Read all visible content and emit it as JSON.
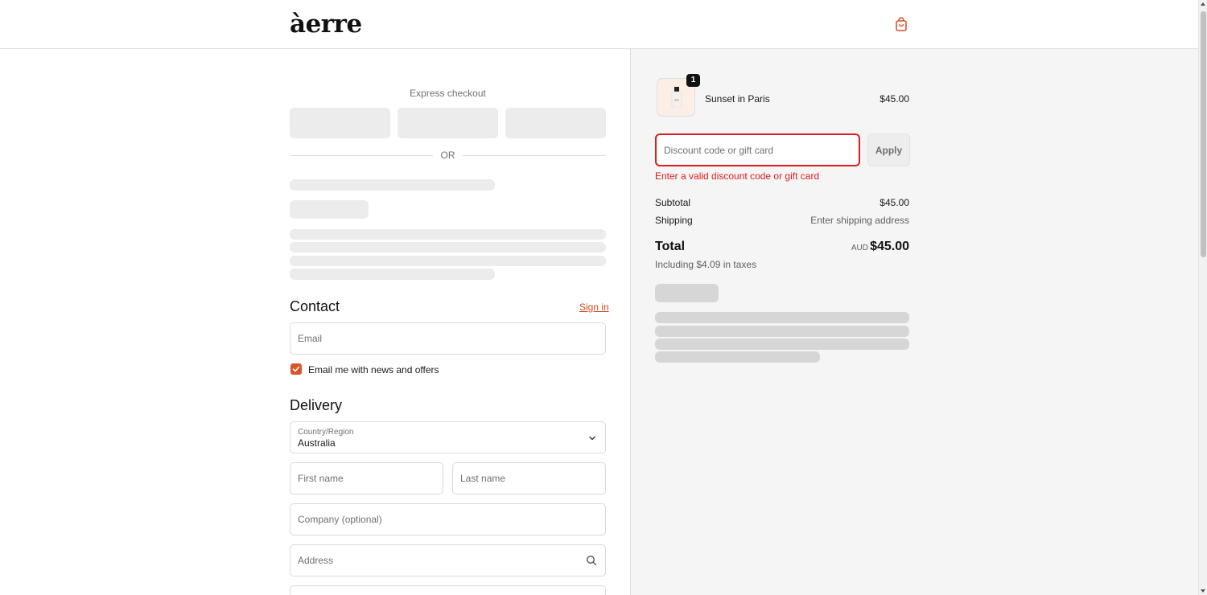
{
  "brand": {
    "logo": "àerre",
    "accent": "#d9542b"
  },
  "header": {
    "cart_icon": "shopping-bag-icon"
  },
  "express": {
    "title": "Express checkout",
    "separator": "OR"
  },
  "contact": {
    "title": "Contact",
    "sign_in": "Sign in",
    "email_placeholder": "Email",
    "newsletter_label": "Email me with news and offers",
    "newsletter_checked": true
  },
  "delivery": {
    "title": "Delivery",
    "country_label": "Country/Region",
    "country_value": "Australia",
    "first_name_placeholder": "First name",
    "last_name_placeholder": "Last name",
    "company_placeholder": "Company (optional)",
    "address_placeholder": "Address"
  },
  "summary": {
    "product": {
      "name": "Sunset in Paris",
      "price": "$45.00",
      "quantity": "1"
    },
    "discount_placeholder": "Discount code or gift card",
    "apply_label": "Apply",
    "error": "Enter a valid discount code or gift card",
    "subtotal_label": "Subtotal",
    "subtotal_value": "$45.00",
    "shipping_label": "Shipping",
    "shipping_value": "Enter shipping address",
    "total_label": "Total",
    "currency": "AUD",
    "total_value": "$45.00",
    "taxes_note": "Including $4.09 in taxes",
    "error_color": "#dd1d1d"
  }
}
